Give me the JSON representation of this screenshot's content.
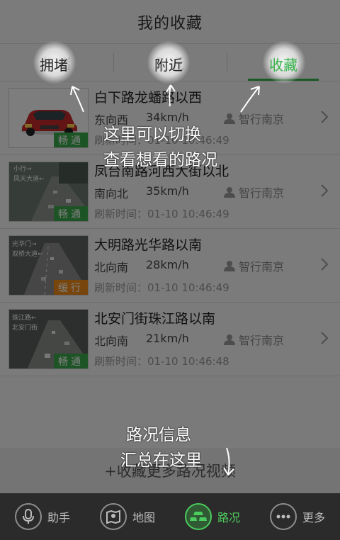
{
  "header": {
    "title": "我的收藏"
  },
  "tabs": [
    {
      "label": "拥堵"
    },
    {
      "label": "附近"
    },
    {
      "label": "收藏"
    }
  ],
  "items": [
    {
      "road": "白下路龙蟠路以西",
      "direction": "东向西",
      "speed": "34km/h",
      "source": "智行南京",
      "refresh": "刷新时间：01-10 10:46:49",
      "status": "畅通",
      "status_color": "#3aa84a",
      "thumb_icon": "car-icon"
    },
    {
      "road": "凤台南路河西大街以北",
      "direction": "南向北",
      "speed": "35km/h",
      "source": "智行南京",
      "refresh": "刷新时间：01-10 10:46:49",
      "status": "畅通",
      "status_color": "#3aa84a",
      "thumb_icon": "traffic-camera-thumbnail"
    },
    {
      "road": "大明路光华路以南",
      "direction": "北向南",
      "speed": "28km/h",
      "source": "智行南京",
      "refresh": "刷新时间：01-10 10:46:49",
      "status": "缓行",
      "status_color": "#f08c1a",
      "thumb_icon": "traffic-camera-thumbnail"
    },
    {
      "road": "北安门街珠江路以南",
      "direction": "北向南",
      "speed": "21km/h",
      "source": "智行南京",
      "refresh": "刷新时间：01-10 10:46:48",
      "status": "畅通",
      "status_color": "#3aa84a",
      "thumb_icon": "traffic-camera-thumbnail"
    }
  ],
  "add_more": "+收藏更多路况视频",
  "bottom_nav": [
    {
      "label": "助手",
      "icon": "microphone-icon"
    },
    {
      "label": "地图",
      "icon": "map-icon"
    },
    {
      "label": "路况",
      "icon": "traffic-icon"
    },
    {
      "label": "更多",
      "icon": "more-icon"
    }
  ],
  "overlay": {
    "hint_tabs_line1": "这里可以切换",
    "hint_tabs_line2": "查看想看的路况",
    "hint_info_line1": "路况信息",
    "hint_info_line2": "汇总在这里"
  },
  "colors": {
    "accent": "#37b34a",
    "smooth": "#3aa84a",
    "slow": "#f08c1a",
    "nav_bg": "#2b2b2b"
  }
}
